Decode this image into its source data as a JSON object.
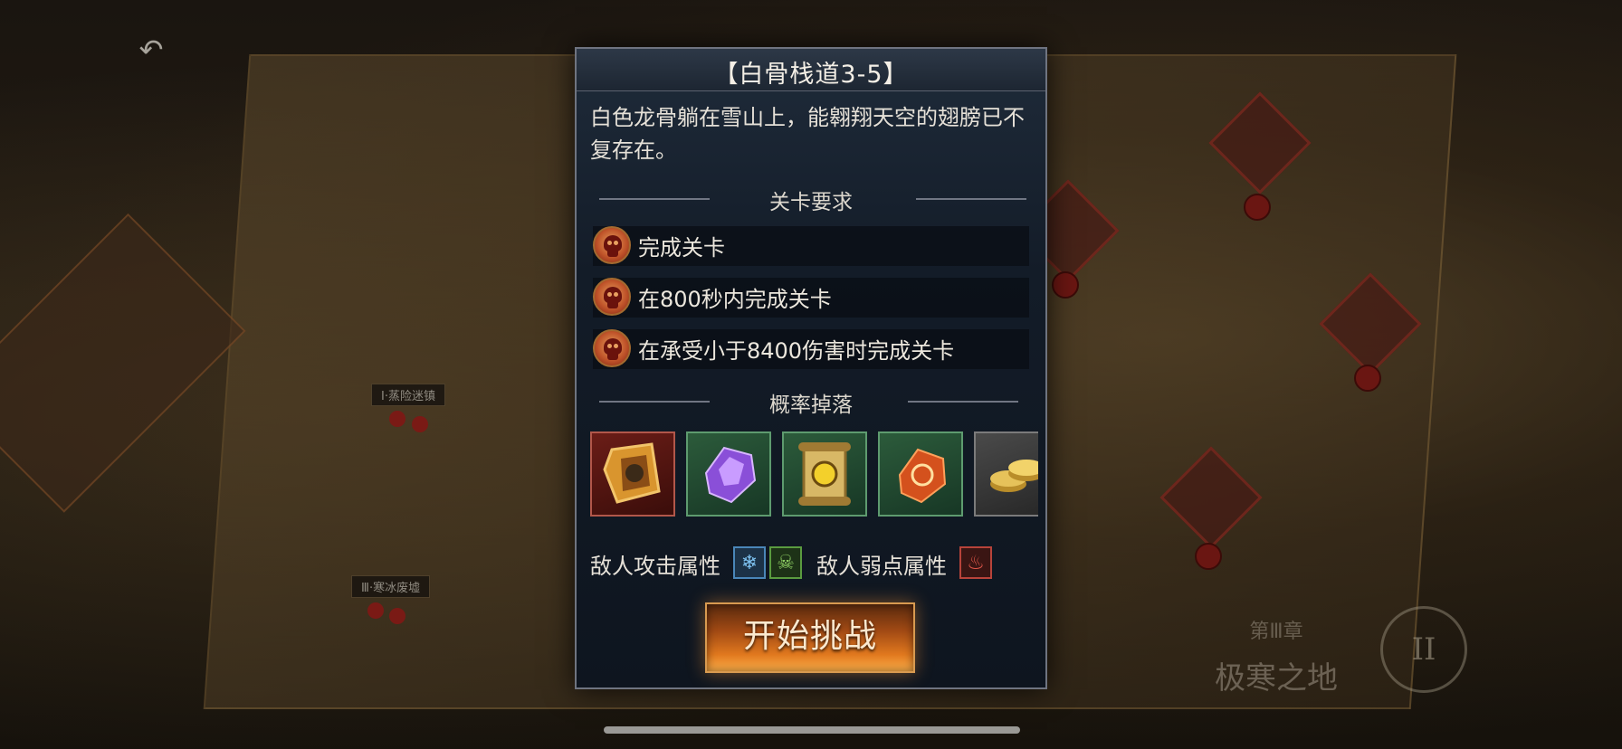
{
  "dialog": {
    "title": "【白骨栈道3-5】",
    "description": "白色龙骨躺在雪山上，能翱翔天空的翅膀已不复存在。",
    "requirements_heading": "关卡要求",
    "requirements": [
      "完成关卡",
      "在800秒内完成关卡",
      "在承受小于8400伤害时完成关卡"
    ],
    "drops_heading": "概率掉落",
    "drops": [
      {
        "name": "amber-crystal",
        "frame": "red"
      },
      {
        "name": "purple-gem",
        "frame": "green"
      },
      {
        "name": "golden-scroll",
        "frame": "green"
      },
      {
        "name": "fire-rune-stone",
        "frame": "green"
      },
      {
        "name": "gold-coins",
        "frame": "grey"
      }
    ],
    "enemy_attack_label": "敌人攻击属性",
    "enemy_attack_attrs": [
      "ice-icon",
      "poison-icon"
    ],
    "enemy_weak_label": "敌人弱点属性",
    "enemy_weak_attrs": [
      "fire-icon"
    ],
    "start_button": "开始挑战"
  },
  "map": {
    "chapter_number": "第Ⅲ章",
    "chapter_name": "极寒之地",
    "emblem_numeral": "II",
    "node_labels": [
      "Ⅰ·蒸险迷镇",
      "Ⅲ·寒冰废墟"
    ]
  },
  "colors": {
    "dialog_bg": "#131c28",
    "button_accent": "#e0781e",
    "ice": "#4a86b8",
    "poison": "#5a9b3f",
    "fire": "#b8433a"
  }
}
